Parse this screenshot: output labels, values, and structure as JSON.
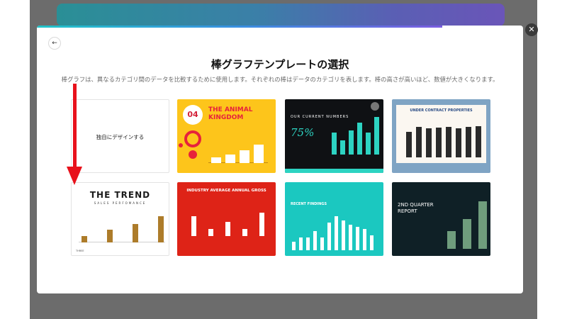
{
  "modal": {
    "title": "棒グラフテンプレートの選択",
    "description": "棒グラフは、異なるカテゴリ間のデータを比較するために使用します。それぞれの棒はデータのカテゴリを表します。棒の高さが高いほど、数値が大きくなります。",
    "blank_card_label": "独自にデザインする"
  },
  "background": {
    "text_1": "",
    "text_2": "",
    "text_3": ""
  },
  "templates": [
    {
      "id": "animal",
      "number": "04",
      "title": "THE ANIMAL KINGDOM",
      "bars": [
        0.18,
        0.28,
        0.4,
        0.6
      ]
    },
    {
      "id": "numbers",
      "title": "OUR CURRENT NUMBERS",
      "percent": "75%",
      "bars": [
        0.55,
        0.35,
        0.6,
        0.8,
        0.55,
        0.95
      ]
    },
    {
      "id": "contract",
      "title": "UNDER CONTRACT PROPERTIES",
      "bars": [
        0.6,
        0.72,
        0.68,
        0.7,
        0.72,
        0.68,
        0.72,
        0.74
      ]
    },
    {
      "id": "trend",
      "title": "THE TREND",
      "subtitle": "SALES PERFOMANCE",
      "footer_left": "THREE",
      "bars": [
        0.2,
        0.4,
        0.6,
        0.85
      ]
    },
    {
      "id": "industry",
      "title": "INDUSTRY AVERAGE ANNUAL GROSS",
      "bars": [
        0.55,
        0.2,
        0.4,
        0.2,
        0.65
      ]
    },
    {
      "id": "findings",
      "title": "RECENT FINDINGS",
      "bars": [
        0.2,
        0.3,
        0.3,
        0.45,
        0.3,
        0.65,
        0.8,
        0.7,
        0.6,
        0.55,
        0.5,
        0.35
      ]
    },
    {
      "id": "quarter",
      "title": "2ND QUARTER REPORT",
      "bars": [
        0.35,
        0.6,
        0.95
      ]
    }
  ],
  "colors": {
    "arrow": "#e8111b",
    "progress_start": "#21c3c8",
    "progress_end": "#7a5de0"
  },
  "icons": {
    "close": "close-icon",
    "back": "arrow-left-icon"
  }
}
